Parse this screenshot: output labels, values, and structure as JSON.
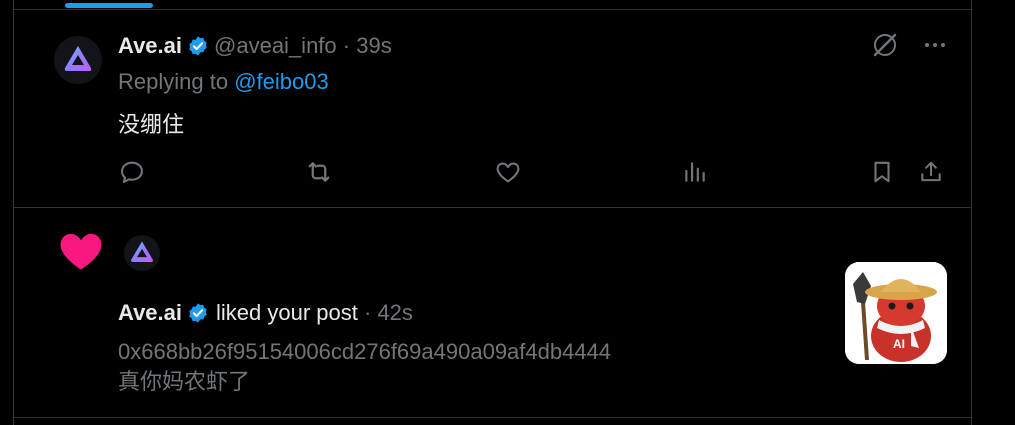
{
  "colors": {
    "background": "#000000",
    "text_primary": "#e7e9ea",
    "text_muted": "#71767b",
    "accent": "#1d9bf0",
    "like": "#f91880",
    "divider": "#2f3336"
  },
  "reply_tweet": {
    "display_name": "Ave.ai",
    "verified": true,
    "handle": "@aveai_info",
    "separator": " · ",
    "time": "39s",
    "replying_prefix": "Replying to ",
    "replying_to": "@feibo03",
    "text": "没绷住",
    "icons": [
      "grok-icon",
      "more-icon",
      "reply-icon",
      "retweet-icon",
      "like-icon",
      "views-icon",
      "bookmark-icon",
      "share-icon"
    ]
  },
  "notification": {
    "type_icon": "heart-icon",
    "display_name": "Ave.ai",
    "verified": true,
    "action_text": "liked your post",
    "separator": " · ",
    "time": "42s",
    "post_lines": [
      "0x668bb26f95154006cd276f69a490a09af4db4444",
      "真你妈农虾了"
    ],
    "thumbnail_text": "AI"
  }
}
